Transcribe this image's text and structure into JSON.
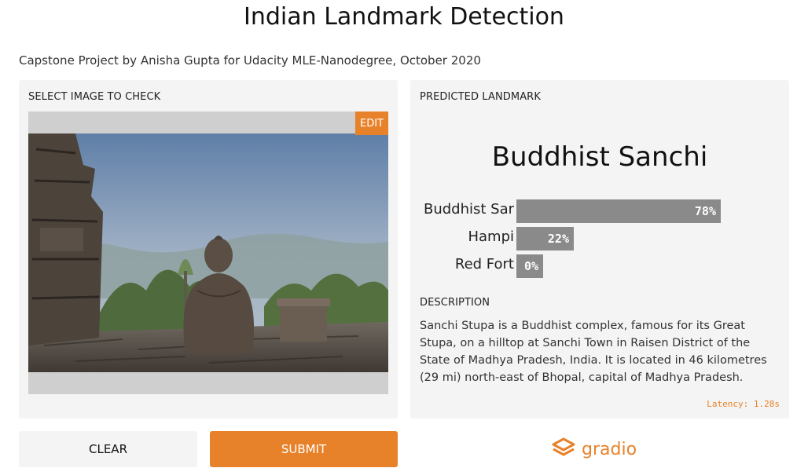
{
  "header": {
    "title": "Indian Landmark Detection",
    "subtitle": "Capstone Project by Anisha Gupta for Udacity MLE-Nanodegree, October 2020"
  },
  "input_panel": {
    "label": "SELECT IMAGE TO CHECK",
    "edit_label": "EDIT"
  },
  "output_panel": {
    "label": "PREDICTED LANDMARK",
    "prediction": "Buddhist Sanchi",
    "confidences": [
      {
        "label": "Buddhist Sar",
        "percent_text": "78%",
        "value": 0.78
      },
      {
        "label": "Hampi",
        "percent_text": "22%",
        "value": 0.22
      },
      {
        "label": "Red Fort",
        "percent_text": "0%",
        "value": 0.0
      }
    ],
    "description_label": "DESCRIPTION",
    "description": "Sanchi Stupa is a Buddhist complex, famous for its Great Stupa, on a hilltop at Sanchi Town in Raisen District of the State of Madhya Pradesh, India. It is located in 46 kilometres (29 mi) north-east of Bhopal, capital of Madhya Pradesh.",
    "latency": "Latency: 1.28s"
  },
  "actions": {
    "clear_label": "CLEAR",
    "submit_label": "SUBMIT"
  },
  "branding": {
    "logo_text": "gradio",
    "logo_icon": "gradio-logo-icon"
  },
  "colors": {
    "accent": "#e8822a",
    "bar": "#8a8a8a",
    "panel_bg": "#f4f4f4"
  }
}
